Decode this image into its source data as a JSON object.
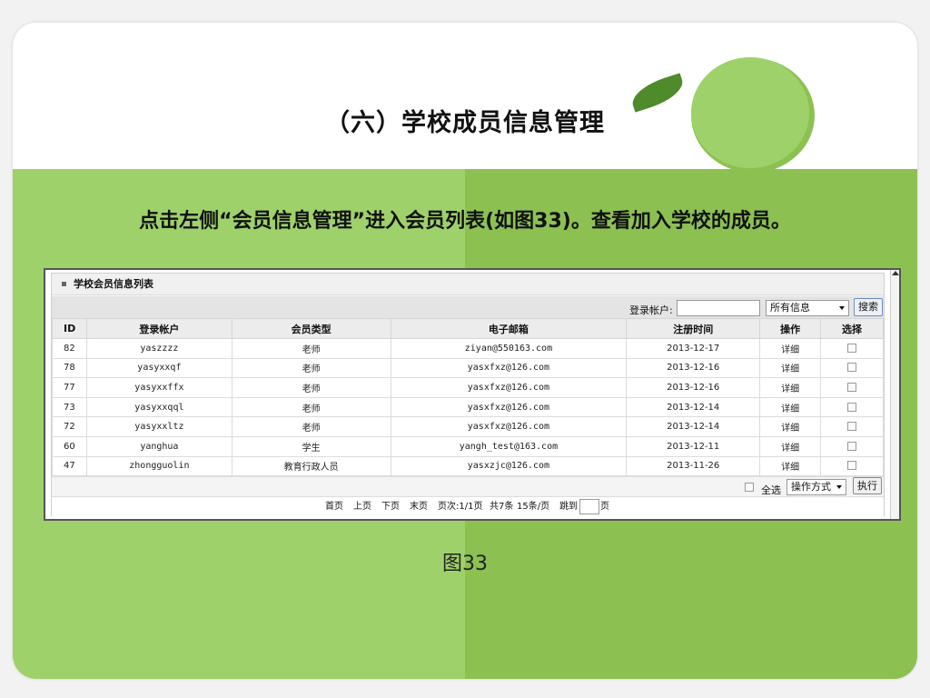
{
  "slide": {
    "title": "（六）学校成员信息管理",
    "instruction": "点击左侧“会员信息管理”进入会员列表(如图33)。查看加入学校的成员。",
    "caption": "图33",
    "colors": {
      "green_light": "#9fd16a",
      "green_mid": "#8cc152",
      "leaf_dark": "#4f8a2b"
    }
  },
  "panel": {
    "title": "学校会员信息列表",
    "search_label": "登录帐户:",
    "search_value": "",
    "filter_selected": "所有信息",
    "search_button": "搜索"
  },
  "table": {
    "headers": [
      "ID",
      "登录帐户",
      "会员类型",
      "电子邮箱",
      "注册时间",
      "操作",
      "选择"
    ],
    "rows": [
      {
        "id": "82",
        "account": "yaszzzz",
        "type": "老师",
        "email": "ziyan@550163.com",
        "date": "2013-12-17",
        "action": "详细"
      },
      {
        "id": "78",
        "account": "yasyxxqf",
        "type": "老师",
        "email": "yasxfxz@126.com",
        "date": "2013-12-16",
        "action": "详细"
      },
      {
        "id": "77",
        "account": "yasyxxffx",
        "type": "老师",
        "email": "yasxfxz@126.com",
        "date": "2013-12-16",
        "action": "详细"
      },
      {
        "id": "73",
        "account": "yasyxxqql",
        "type": "老师",
        "email": "yasxfxz@126.com",
        "date": "2013-12-14",
        "action": "详细"
      },
      {
        "id": "72",
        "account": "yasyxxltz",
        "type": "老师",
        "email": "yasxfxz@126.com",
        "date": "2013-12-14",
        "action": "详细"
      },
      {
        "id": "60",
        "account": "yanghua",
        "type": "学生",
        "email": "yangh_test@163.com",
        "date": "2013-12-11",
        "action": "详细"
      },
      {
        "id": "47",
        "account": "zhongguolin",
        "type": "教育行政人员",
        "email": "yasxzjc@126.com",
        "date": "2013-11-26",
        "action": "详细"
      }
    ]
  },
  "footer": {
    "select_all": "全选",
    "op_selected": "操作方式",
    "exec_button": "执行"
  },
  "pagination": {
    "first": "首页",
    "prev": "上页",
    "next": "下页",
    "last": "末页",
    "page_info": "页次:1/1页",
    "total": "共7条",
    "per_page": "15条/页",
    "jump_label": "跳到",
    "page_suffix": "页"
  }
}
